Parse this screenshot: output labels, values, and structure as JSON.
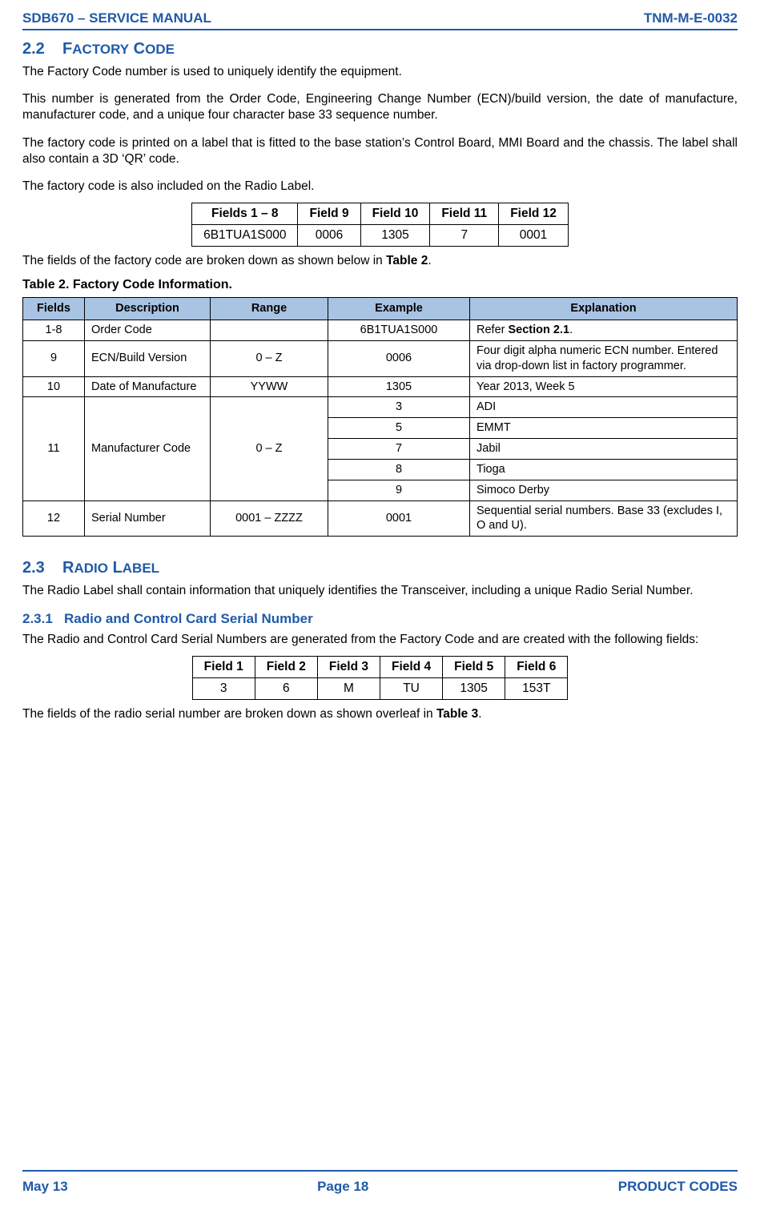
{
  "header": {
    "left": "SDB670 – SERVICE MANUAL",
    "right": "TNM-M-E-0032"
  },
  "footer": {
    "left": "May 13",
    "center": "Page 18",
    "right": "PRODUCT CODES"
  },
  "s22": {
    "num": "2.2",
    "title_first": "F",
    "title_rest_word1": "ACTORY",
    "title_word2_first": "C",
    "title_word2_rest": "ODE",
    "p1": "The Factory Code number is used to uniquely identify the equipment.",
    "p2": "This number is generated from the Order Code, Engineering Change Number (ECN)/build version, the date of manufacture, manufacturer code, and a unique four character base 33 sequence number.",
    "p3": "The factory code is printed on a label that is fitted to the base station’s Control Board, MMI Board and the chassis.  The label shall also contain a 3D ‘QR’ code.",
    "p4": "The factory code is also included on the Radio Label."
  },
  "tbl_fc_example": {
    "h": [
      "Fields 1 – 8",
      "Field 9",
      "Field 10",
      "Field 11",
      "Field 12"
    ],
    "r": [
      "6B1TUA1S000",
      "0006",
      "1305",
      "7",
      "0001"
    ]
  },
  "between1_a": "The fields of the factory code are broken down as shown below in ",
  "between1_b": "Table 2",
  "between1_c": ".",
  "tbl2": {
    "caption": "Table 2.  Factory Code Information.",
    "head": [
      "Fields",
      "Description",
      "Range",
      "Example",
      "Explanation"
    ],
    "r1": {
      "f": "1-8",
      "d": "Order Code",
      "rg": "",
      "ex": "6B1TUA1S000",
      "exp_a": "Refer ",
      "exp_b": "Section 2.1",
      "exp_c": "."
    },
    "r2": {
      "f": "9",
      "d": "ECN/Build Version",
      "rg": "0 – Z",
      "ex": "0006",
      "exp": "Four digit alpha numeric ECN number.  Entered via drop-down list in factory programmer."
    },
    "r3": {
      "f": "10",
      "d": "Date of Manufacture",
      "rg": "YYWW",
      "ex": "1305",
      "exp": "Year 2013, Week 5"
    },
    "r4": {
      "f": "11",
      "d": "Manufacturer Code",
      "rg": "0 – Z",
      "rows": [
        {
          "ex": "3",
          "exp": "ADI"
        },
        {
          "ex": "5",
          "exp": "EMMT"
        },
        {
          "ex": "7",
          "exp": "Jabil"
        },
        {
          "ex": "8",
          "exp": "Tioga"
        },
        {
          "ex": "9",
          "exp": "Simoco Derby"
        }
      ]
    },
    "r5": {
      "f": "12",
      "d": "Serial Number",
      "rg": "0001 – ZZZZ",
      "ex": "0001",
      "exp": "Sequential serial numbers.  Base 33 (excludes I, O and U)."
    }
  },
  "s23": {
    "num": "2.3",
    "title_first": "R",
    "title_rest_word1": "ADIO",
    "title_word2_first": "L",
    "title_word2_rest": "ABEL",
    "p1": "The Radio Label shall contain information that uniquely identifies the Transceiver, including a unique Radio Serial Number."
  },
  "s231": {
    "num": "2.3.1",
    "title": "Radio and Control Card Serial Number",
    "p1": "The Radio and Control Card Serial Numbers are generated from the Factory Code and are created with the following fields:"
  },
  "tbl_rs_example": {
    "h": [
      "Field 1",
      "Field 2",
      "Field 3",
      "Field 4",
      "Field 5",
      "Field 6"
    ],
    "r": [
      "3",
      "6",
      "M",
      "TU",
      "1305",
      "153T"
    ]
  },
  "closing_a": "The fields of the radio serial number are broken down as shown overleaf in ",
  "closing_b": "Table 3",
  "closing_c": "."
}
